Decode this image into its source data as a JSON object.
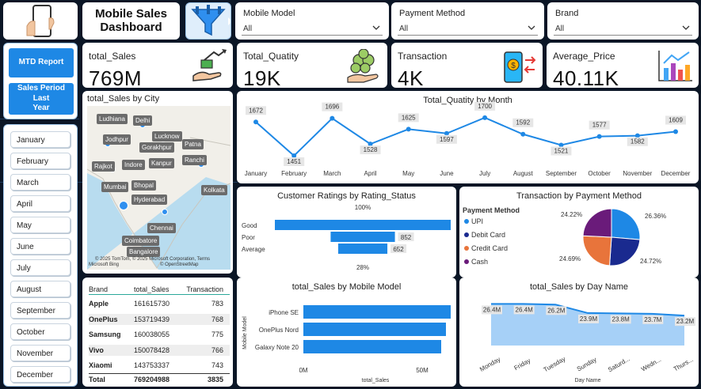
{
  "header": {
    "title_line1": "Mobile Sales",
    "title_line2": "Dashboard"
  },
  "slicers": [
    {
      "label": "Mobile Model",
      "value": "All"
    },
    {
      "label": "Payment Method",
      "value": "All"
    },
    {
      "label": "Brand",
      "value": "All"
    }
  ],
  "buttons": {
    "mtd": "MTD Report",
    "spl_line1": "Sales Period Last",
    "spl_line2": "Year"
  },
  "kpis": [
    {
      "label": "total_Sales",
      "value": "769M"
    },
    {
      "label": "Total_Quatity",
      "value": "19K"
    },
    {
      "label": "Transaction",
      "value": "4K"
    },
    {
      "label": "Average_Price",
      "value": "40.11K"
    }
  ],
  "months": [
    "January",
    "February",
    "March",
    "April",
    "May",
    "June",
    "July",
    "August",
    "September",
    "October",
    "November",
    "December"
  ],
  "map": {
    "title": "total_Sales by City",
    "cities": [
      "Ludhiana",
      "Delhi",
      "Jodhpur",
      "Lucknow",
      "Gorakhpur",
      "Patna",
      "Ranchi",
      "Rajkot",
      "Indore",
      "Kanpur",
      "Mumbai",
      "Bhopal",
      "Kolkata",
      "Hyderabad",
      "Chennai",
      "Coimbatore",
      "Bangalore"
    ],
    "credit": "© 2025 TomTom, © 2025 Microsoft Corporation, Terms",
    "credit2": "© OpenStreetMap",
    "bing": "Microsoft Bing"
  },
  "table": {
    "headers": [
      "Brand",
      "total_Sales",
      "Transaction"
    ],
    "rows": [
      [
        "Apple",
        "161615730",
        "783"
      ],
      [
        "OnePlus",
        "153719439",
        "768"
      ],
      [
        "Samsung",
        "160038055",
        "775"
      ],
      [
        "Vivo",
        "150078428",
        "766"
      ],
      [
        "Xiaomi",
        "143753337",
        "743"
      ]
    ],
    "total": [
      "Total",
      "769204988",
      "3835"
    ]
  },
  "chart_data": [
    {
      "type": "line",
      "title": "Total_Quatity by Month",
      "categories": [
        "January",
        "February",
        "March",
        "April",
        "May",
        "June",
        "July",
        "August",
        "September",
        "October",
        "November",
        "December"
      ],
      "values": [
        1672,
        1451,
        1696,
        1528,
        1625,
        1597,
        1700,
        1592,
        1521,
        1577,
        1582,
        1609
      ],
      "data_labels": [
        "1672",
        "1451",
        "1696",
        "1528",
        "1625",
        "1597",
        "1700",
        "1592",
        "1521",
        "1577",
        "1582",
        "1609"
      ],
      "color": "#1e88e5"
    },
    {
      "type": "bar",
      "title": "Customer Ratings by Rating_Status",
      "categories": [
        "Good",
        "Poor",
        "Average"
      ],
      "values": [
        2331,
        852,
        652
      ],
      "data_labels": [
        "",
        "852",
        "652"
      ],
      "top_label": "100%",
      "bottom_label": "28%",
      "color": "#1e88e5"
    },
    {
      "type": "pie",
      "title": "Transaction by Payment Method",
      "legend_title": "Payment Method",
      "categories": [
        "UPI",
        "Debit Card",
        "Credit Card",
        "Cash"
      ],
      "values": [
        26.36,
        24.72,
        24.69,
        24.22
      ],
      "data_labels": [
        "26.36%",
        "24.72%",
        "24.69%",
        "24.22%"
      ],
      "colors": [
        "#1e88e5",
        "#1a2a8f",
        "#e8743b",
        "#6a1b7a"
      ]
    },
    {
      "type": "bar",
      "title": "total_Sales by Mobile Model",
      "categories": [
        "iPhone SE",
        "OnePlus Nord",
        "Galaxy Note 20"
      ],
      "values": [
        62,
        60,
        58
      ],
      "xlabel": "total_Sales",
      "ylabel": "Mobile Model",
      "xticks": [
        "0M",
        "50M"
      ],
      "color": "#1e88e5"
    },
    {
      "type": "area",
      "title": "total_Sales by Day Name",
      "categories": [
        "Monday",
        "Friday",
        "Tuesday",
        "Sunday",
        "Saturday",
        "Wednesday",
        "Thursday"
      ],
      "tick_labels": [
        "Monday",
        "Friday",
        "Tuesday",
        "Sunday",
        "Saturd...",
        "Wedn...",
        "Thurs..."
      ],
      "values": [
        26.4,
        26.4,
        26.2,
        23.9,
        23.8,
        23.7,
        23.2
      ],
      "data_labels": [
        "26.4M",
        "26.4M",
        "26.2M",
        "23.9M",
        "23.8M",
        "23.7M",
        "23.2M"
      ],
      "xlabel": "Day Name",
      "color": "#90c4f5"
    }
  ]
}
